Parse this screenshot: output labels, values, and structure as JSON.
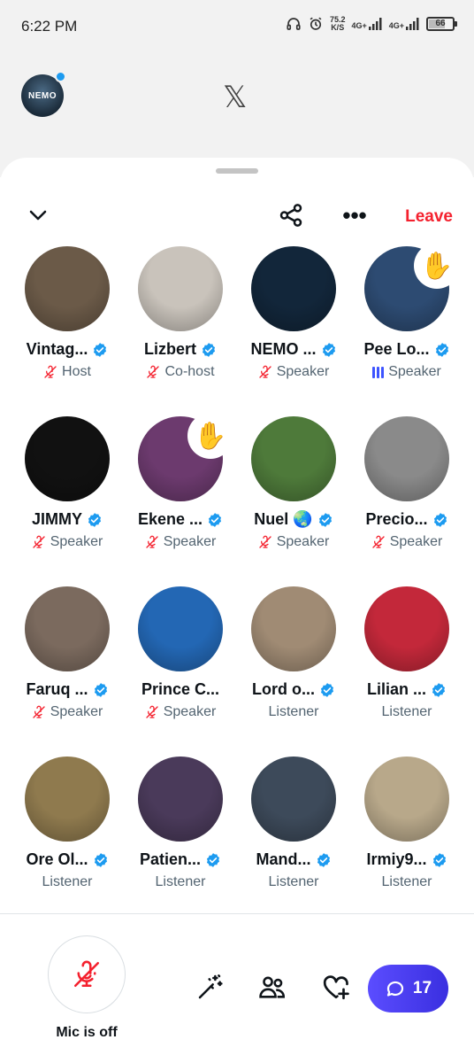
{
  "status_bar": {
    "time": "6:22 PM",
    "speed_value": "75.2",
    "speed_unit": "K/S",
    "network_1": "4G+",
    "network_2": "4G+",
    "battery": "66",
    "battery_level": 0.66
  },
  "app_header": {
    "avatar_text": "NEMO",
    "logo": "𝕏"
  },
  "space": {
    "leave_label": "Leave",
    "more_label": "•••",
    "participants": [
      {
        "name": "Vintag...",
        "verified": true,
        "role": "Host",
        "mic": "off",
        "hand": false,
        "avatar_color": "#6b5a48",
        "icon": "avatar-photo"
      },
      {
        "name": "Lizbert",
        "verified": true,
        "role": "Co-host",
        "mic": "off",
        "hand": false,
        "avatar_color": "#c9c3bb",
        "icon": "avatar-photo"
      },
      {
        "name": "NEMO ...",
        "verified": true,
        "role": "Speaker",
        "mic": "off",
        "hand": false,
        "avatar_color": "#12263a",
        "icon": "avatar-photo"
      },
      {
        "name": "Pee Lo...",
        "verified": true,
        "role": "Speaker",
        "mic": "speaking",
        "hand": true,
        "avatar_color": "#2d4b72",
        "icon": "avatar-photo"
      },
      {
        "name": "JIMMY",
        "verified": true,
        "role": "Speaker",
        "mic": "off",
        "hand": false,
        "avatar_color": "#111111",
        "icon": "avatar-photo"
      },
      {
        "name": "Ekene ...",
        "verified": true,
        "role": "Speaker",
        "mic": "off",
        "hand": true,
        "avatar_color": "#6c3a6e",
        "icon": "avatar-photo"
      },
      {
        "name": "Nuel 🌏",
        "verified": true,
        "role": "Speaker",
        "mic": "off",
        "hand": false,
        "avatar_color": "#4e7a3a",
        "icon": "avatar-photo"
      },
      {
        "name": "Precio...",
        "verified": true,
        "role": "Speaker",
        "mic": "off",
        "hand": false,
        "avatar_color": "#8a8a8a",
        "icon": "avatar-photo"
      },
      {
        "name": "Faruq ...",
        "verified": true,
        "role": "Speaker",
        "mic": "off",
        "hand": false,
        "avatar_color": "#7b6a5e",
        "icon": "avatar-photo"
      },
      {
        "name": "Prince C...",
        "verified": false,
        "role": "Speaker",
        "mic": "off",
        "hand": false,
        "avatar_color": "#2367b4",
        "icon": "avatar-photo"
      },
      {
        "name": "Lord o...",
        "verified": true,
        "role": "Listener",
        "mic": "none",
        "hand": false,
        "avatar_color": "#a08b74",
        "icon": "avatar-photo"
      },
      {
        "name": "Lilian ...",
        "verified": true,
        "role": "Listener",
        "mic": "none",
        "hand": false,
        "avatar_color": "#c3283a",
        "icon": "avatar-photo"
      },
      {
        "name": "Ore Ol...",
        "verified": true,
        "role": "Listener",
        "mic": "none",
        "hand": false,
        "avatar_color": "#8f7a4e",
        "icon": "avatar-photo"
      },
      {
        "name": "Patien...",
        "verified": true,
        "role": "Listener",
        "mic": "none",
        "hand": false,
        "avatar_color": "#4a3a5a",
        "icon": "avatar-photo"
      },
      {
        "name": "Mand...",
        "verified": true,
        "role": "Listener",
        "mic": "none",
        "hand": false,
        "avatar_color": "#3d4a5a",
        "icon": "avatar-photo"
      },
      {
        "name": "Irmiy9...",
        "verified": true,
        "role": "Listener",
        "mic": "none",
        "hand": false,
        "avatar_color": "#b8a88a",
        "icon": "avatar-photo"
      }
    ]
  },
  "bottom_bar": {
    "mic_label": "Mic is off",
    "chat_count": "17"
  },
  "colors": {
    "accent_red": "#f4212e",
    "verified_blue": "#1d9bf0",
    "chat_purple": "#5b4dff"
  }
}
